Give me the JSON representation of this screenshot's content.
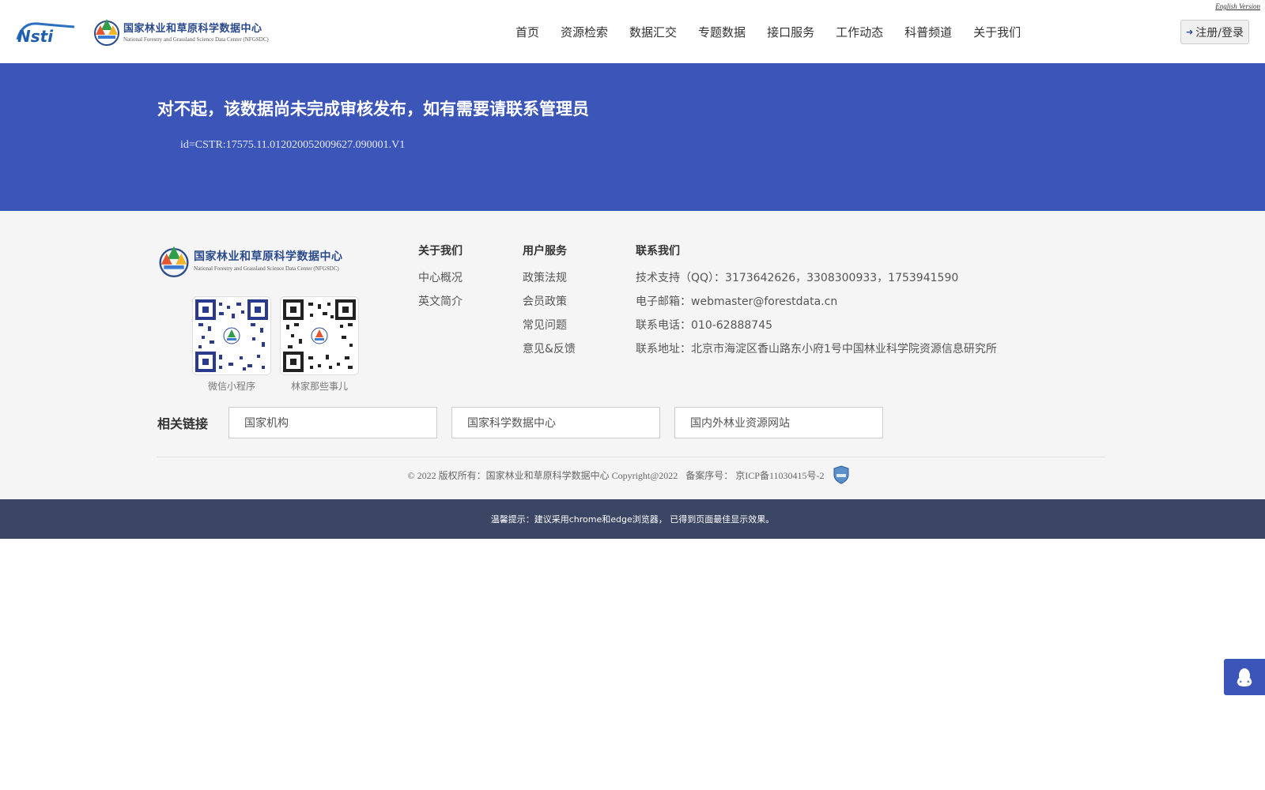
{
  "header": {
    "english_link": "English Version",
    "nsti_logo_text": "NSTI",
    "brand_cn": "国家林业和草原科学数据中心",
    "brand_en": "National Forestry and Grassland Science Data Center (NFGSDC)",
    "nav": [
      "首页",
      "资源检索",
      "数据汇交",
      "专题数据",
      "接口服务",
      "工作动态",
      "科普频道",
      "关于我们"
    ],
    "login_label": "注册/登录",
    "login_icon": "sign-in-icon"
  },
  "banner": {
    "title": "对不起，该数据尚未完成审核发布，如有需要请联系管理员",
    "id_text": "id=CSTR:17575.11.012020052009627.090001.V1"
  },
  "footer": {
    "brand_cn": "国家林业和草原科学数据中心",
    "brand_en": "National Forestry and Grassland Science Data Center (NFGSDC)",
    "qr_codes": [
      {
        "caption": "微信小程序"
      },
      {
        "caption": "林家那些事儿"
      }
    ],
    "about": {
      "title": "关于我们",
      "items": [
        "中心概况",
        "英文简介"
      ]
    },
    "services": {
      "title": "用户服务",
      "items": [
        "政策法规",
        "会员政策",
        "常见问题",
        "意见&反馈"
      ]
    },
    "contact": {
      "title": "联系我们",
      "items": [
        "技术支持（QQ）：3173642626，3308300933，1753941590",
        "电子邮箱：webmaster@forestdata.cn",
        "联系电话：010-62888745",
        "联系地址：北京市海淀区香山路东小府1号中国林业科学院资源信息研究所"
      ]
    },
    "related": {
      "title": "相关链接",
      "links": [
        "国家机构",
        "国家科学数据中心",
        "国内外林业资源网站"
      ]
    },
    "copyright": "© 2022 版权所有：国家林业和草原科学数据中心 Copyright@2022",
    "icp": "备案序号： 京ICP备11030415号-2",
    "tip": "温馨提示：建议采用chrome和edge浏览器， 已得到页面最佳显示效果。"
  },
  "colors": {
    "banner": "#3c55b8",
    "tip_bar": "#3a4664",
    "brand_text": "#2a4a8c"
  },
  "floating": {
    "qq_icon": "qq-icon"
  }
}
